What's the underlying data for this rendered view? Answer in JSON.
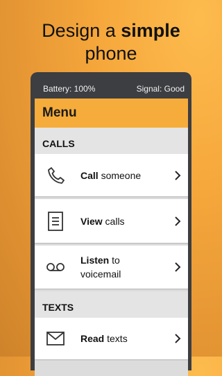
{
  "headline": {
    "line1_pre": "Design a ",
    "line1_bold": "simple",
    "line2": "phone"
  },
  "status": {
    "battery": "Battery: 100%",
    "signal": "Signal: Good"
  },
  "menu": {
    "title": "Menu"
  },
  "sections": {
    "calls": "CALLS",
    "texts": "TEXTS"
  },
  "items": {
    "call": {
      "bold": "Call",
      "rest": " someone",
      "icon": "phone-icon"
    },
    "view": {
      "bold": "View",
      "rest": " calls",
      "icon": "call-log-icon"
    },
    "listen": {
      "bold": "Listen",
      "rest": " to",
      "line2": "voicemail",
      "icon": "voicemail-icon"
    },
    "read": {
      "bold": "Read",
      "rest": " texts",
      "icon": "envelope-icon"
    }
  },
  "colors": {
    "accent": "#f5ac3b",
    "phone_frame": "#3c3e42",
    "screen_bg": "#dcdcdc"
  }
}
